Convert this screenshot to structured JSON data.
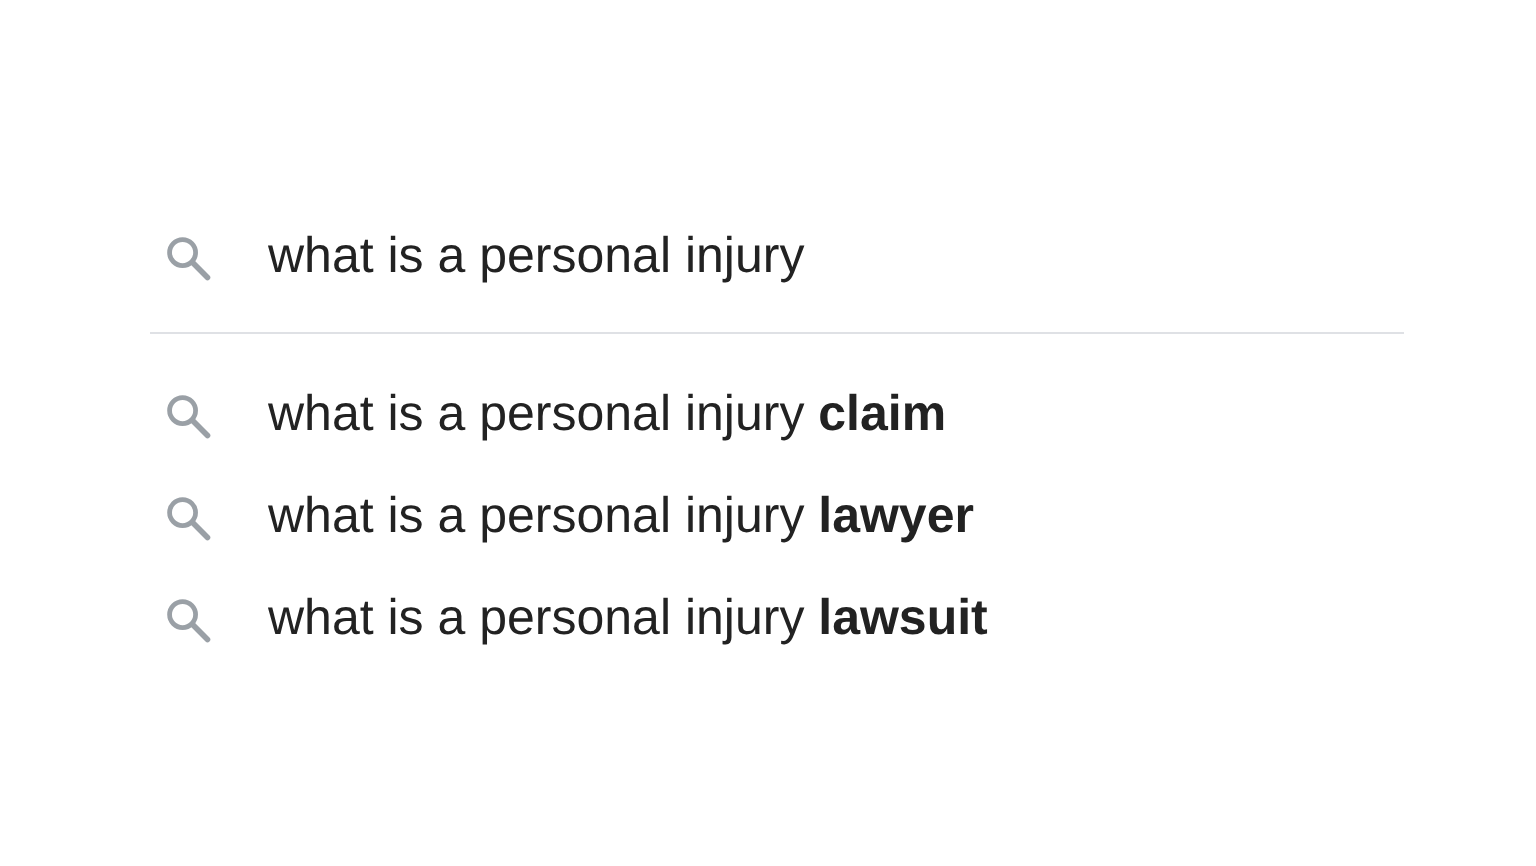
{
  "search": {
    "value": "what is a personal injury"
  },
  "suggestions": [
    {
      "text": "what is a personal injury **claim**"
    },
    {
      "text": "what is a personal injury **lawyer**"
    },
    {
      "text": "what is a personal injury **lawsuit**"
    }
  ]
}
